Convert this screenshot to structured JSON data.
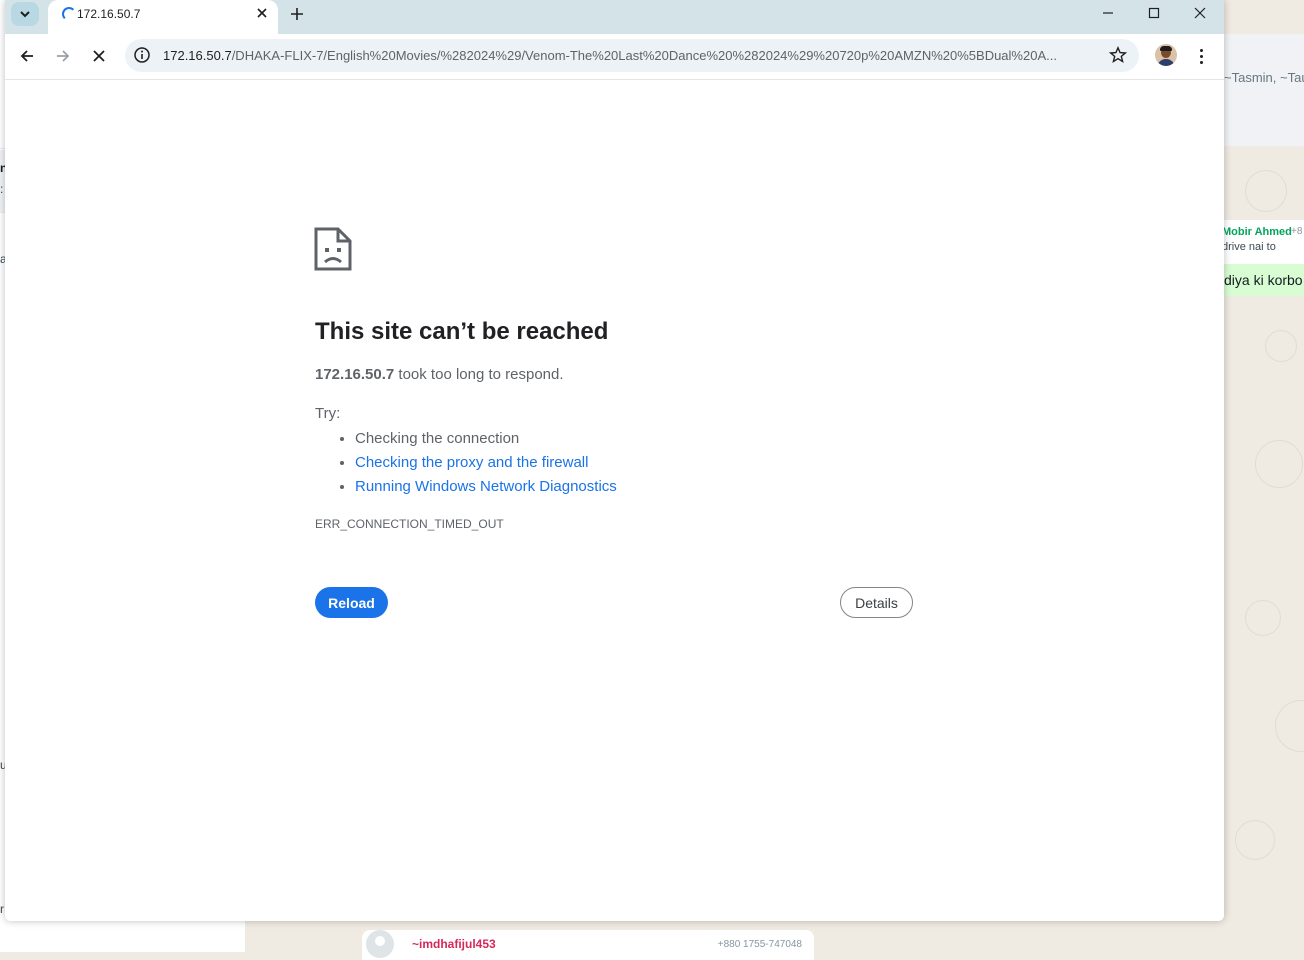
{
  "background_app": {
    "left_fragments": [
      "n",
      ":",
      "a",
      "u",
      "r"
    ],
    "group_members": "~Tasmin, ~Tau",
    "message_sender": "Mobir Ahmed",
    "message_sender_phone": "+8",
    "message_text": "drive nai to",
    "sent_message": "diya ki korbo",
    "bottom_sender": "~imdhafijul453",
    "bottom_phone": "+880 1755-747048"
  },
  "browser": {
    "tab_title": "172.16.50.7",
    "url_host": "172.16.50.7",
    "url_path": "/DHAKA-FLIX-7/English%20Movies/%282024%29/Venom-The%20Last%20Dance%20%282024%29%20720p%20AMZN%20%5BDual%20A...",
    "icons": {
      "tab_search": "chevron-down-icon",
      "loading": "spinner-icon",
      "tab_close": "close-icon",
      "new_tab": "plus-icon",
      "minimize": "minimize-icon",
      "maximize": "maximize-icon",
      "window_close": "close-icon",
      "back": "arrow-left-icon",
      "forward": "arrow-right-icon",
      "stop": "stop-icon",
      "site_info": "info-icon",
      "bookmark": "star-icon",
      "menu": "kebab-menu-icon"
    }
  },
  "error_page": {
    "title": "This site can’t be reached",
    "host": "172.16.50.7",
    "description": " took too long to respond.",
    "try_label": "Try:",
    "suggestions": [
      "Checking the connection",
      "Checking the proxy and the firewall",
      "Running Windows Network Diagnostics"
    ],
    "error_code": "ERR_CONNECTION_TIMED_OUT",
    "reload_label": "Reload",
    "details_label": "Details",
    "icon": "sad-page-icon"
  },
  "colors": {
    "accent": "#1a73e8",
    "tabstrip": "#d3e3e8",
    "text": "#202124",
    "secondary_text": "#5f6368"
  }
}
